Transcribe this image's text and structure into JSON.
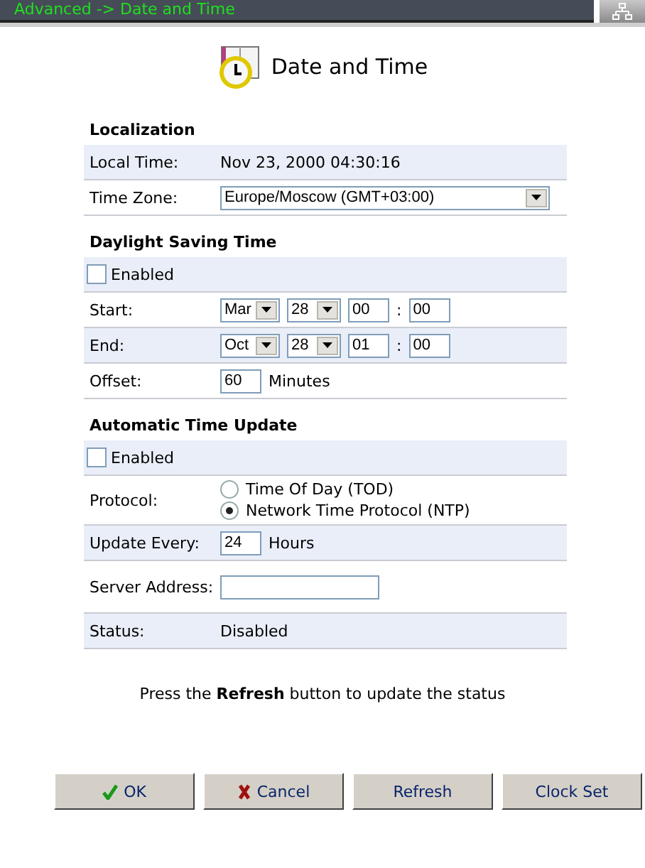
{
  "breadcrumb": "Advanced -> Date and Time",
  "title": "Date and Time",
  "sections": [
    {
      "heading": "Localization",
      "rows": [
        {
          "kind": "text",
          "label": "Local Time:",
          "value": "Nov 23, 2000 04:30:16"
        },
        {
          "kind": "select",
          "label": "Time Zone:",
          "value": "Europe/Moscow (GMT+03:00)"
        }
      ]
    },
    {
      "heading": "Daylight Saving Time",
      "rows": [
        {
          "kind": "checkbox",
          "label": "Enabled",
          "checked": false
        },
        {
          "kind": "datetime",
          "label": "Start:",
          "month": "Mar",
          "day": "28",
          "hour": "00",
          "minute": "00",
          "separator": ":"
        },
        {
          "kind": "datetime",
          "label": "End:",
          "month": "Oct",
          "day": "28",
          "hour": "01",
          "minute": "00",
          "separator": ":"
        },
        {
          "kind": "number",
          "label": "Offset:",
          "value": "60",
          "unit": "Minutes"
        }
      ]
    },
    {
      "heading": "Automatic Time Update",
      "rows": [
        {
          "kind": "checkbox",
          "label": "Enabled",
          "checked": false
        },
        {
          "kind": "radio",
          "label": "Protocol:",
          "options": [
            {
              "label": "Time Of Day (TOD)",
              "selected": false
            },
            {
              "label": "Network Time Protocol (NTP)",
              "selected": true
            }
          ]
        },
        {
          "kind": "number",
          "label": "Update Every:",
          "value": "24",
          "unit": "Hours"
        },
        {
          "kind": "input",
          "label": "Server Address:",
          "value": ""
        },
        {
          "kind": "text",
          "label": "Status:",
          "value": "Disabled"
        }
      ]
    }
  ],
  "note": "Press the **Refresh** button to update the status",
  "buttons": [
    {
      "label": "OK",
      "kind": "ok"
    },
    {
      "label": "Cancel",
      "kind": "cancel"
    },
    {
      "label": "Refresh",
      "kind": "plain"
    },
    {
      "label": "Clock Set",
      "kind": "plain"
    }
  ]
}
